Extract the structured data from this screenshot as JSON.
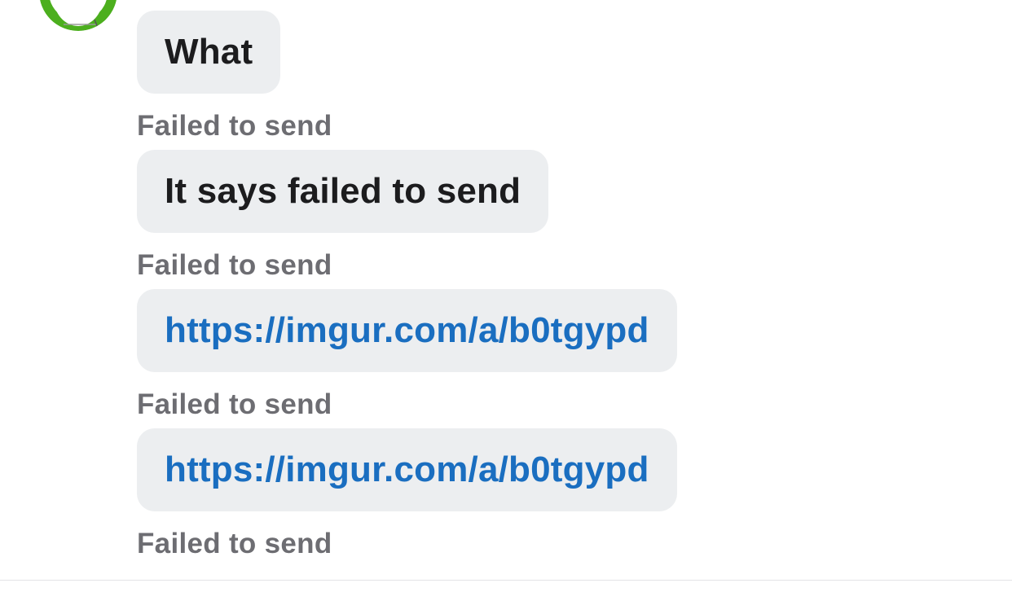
{
  "chat": {
    "messages": [
      {
        "text": "What",
        "is_link": false,
        "status": "Failed to send"
      },
      {
        "text": "It says failed to send",
        "is_link": false,
        "status": "Failed to send"
      },
      {
        "text": "https://imgur.com/a/b0tgypd",
        "is_link": true,
        "status": "Failed to send"
      },
      {
        "text": "https://imgur.com/a/b0tgypd",
        "is_link": true,
        "status": "Failed to send"
      }
    ]
  },
  "colors": {
    "bubble_background": "#eceef0",
    "link_text": "#1a6ec0",
    "status_text": "#6d6d72",
    "avatar_ring": "#4caf1e"
  },
  "icons": {
    "avatar": "contact-avatar-icon"
  }
}
